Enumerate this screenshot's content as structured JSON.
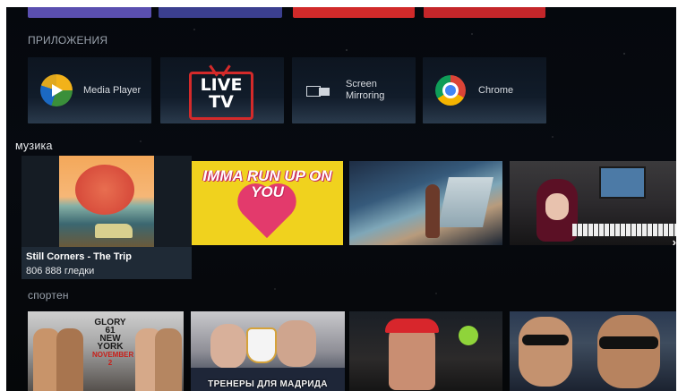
{
  "sections": {
    "apps_label": "ПРИЛОЖЕНИЯ",
    "music_label": "музика",
    "sport_label": "спортен"
  },
  "apps": [
    {
      "name": "Media Player",
      "icon": "media-player-icon"
    },
    {
      "name": "LIVE TV",
      "icon": "live-tv-logo"
    },
    {
      "name": "Screen Mirroring",
      "icon": "screen-mirroring-icon"
    },
    {
      "name": "Chrome",
      "icon": "chrome-icon"
    }
  ],
  "apps_live": {
    "line1": "LIVE",
    "line2": "TV"
  },
  "apps_mirror": {
    "line1": "Screen",
    "line2": "Mirroring"
  },
  "music": {
    "focused": {
      "title": "Still Corners - The Trip",
      "views": "806 888 гледки"
    },
    "yellow_thumb_text": "IMMA RUN UP ON YOU",
    "more_arrow": "›"
  },
  "sport": {
    "glory": {
      "line1": "GLORY 61",
      "line2": "NEW YORK",
      "line3": "NOVEMBER 2"
    },
    "coach_caption": "ТРЕНЕРЫ ДЛЯ МАДРИДА"
  },
  "colors": {
    "background": "#05080d",
    "live_tv_red": "#d42a2a",
    "focus_card": "#1f2a36",
    "yellow_thumb": "#f0d21e"
  }
}
